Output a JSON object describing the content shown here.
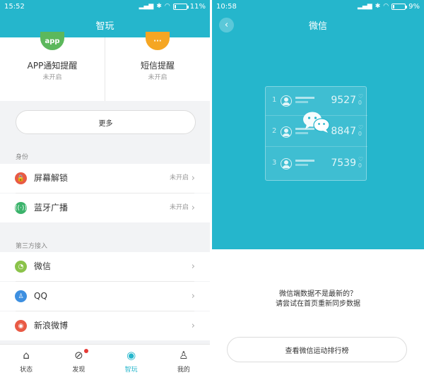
{
  "left": {
    "status": {
      "time": "15:52",
      "battery": "11%",
      "battery_level": 0.11
    },
    "title": "智玩",
    "notify_cards": [
      {
        "icon": "app-icon",
        "icon_text": "app",
        "title": "APP通知提醒",
        "status": "未开启"
      },
      {
        "icon": "sms-icon",
        "icon_text": "···",
        "title": "短信提醒",
        "status": "未开启"
      }
    ],
    "more_label": "更多",
    "sections": {
      "identity": "身份",
      "third_party": "第三方接入"
    },
    "identity_rows": [
      {
        "icon": "lock-icon",
        "label": "屏幕解锁",
        "value": "未开启"
      },
      {
        "icon": "bluetooth-icon",
        "label": "蓝牙广播",
        "value": "未开启"
      }
    ],
    "third_party_rows": [
      {
        "icon": "wechat-icon",
        "label": "微信"
      },
      {
        "icon": "qq-icon",
        "label": "QQ"
      },
      {
        "icon": "weibo-icon",
        "label": "新浪微博"
      }
    ],
    "tabs": [
      {
        "icon": "home-icon",
        "label": "状态"
      },
      {
        "icon": "compass-icon",
        "label": "发现"
      },
      {
        "icon": "target-icon",
        "label": "智玩"
      },
      {
        "icon": "person-icon",
        "label": "我的"
      }
    ],
    "colors": {
      "accent": "#25b6cc",
      "green": "#5cb85c",
      "orange": "#f5a623",
      "red": "#e95a45"
    }
  },
  "right": {
    "status": {
      "time": "10:58",
      "battery": "9%",
      "battery_level": 0.09
    },
    "title": "微信",
    "ranking": [
      {
        "rank": "1",
        "steps": "9527"
      },
      {
        "rank": "2",
        "steps": "8847"
      },
      {
        "rank": "3",
        "steps": "7539"
      }
    ],
    "message_line1": "微信端数据不是最新的？",
    "message_line2": "请尝试在首页重新同步数据",
    "button_label": "查看微信运动排行榜"
  }
}
